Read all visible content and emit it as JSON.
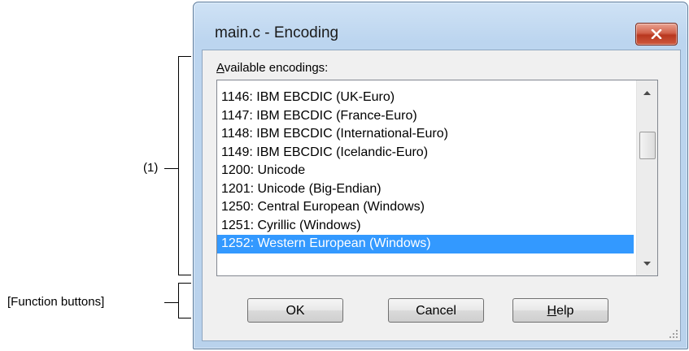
{
  "annotations": {
    "list_callout": "(1)",
    "buttons_callout": "[Function buttons]"
  },
  "window": {
    "title": "main.c - Encoding",
    "close_icon": "close-icon"
  },
  "list": {
    "label_mnemonic": "A",
    "label_rest": "vailable encodings:",
    "items": [
      "1146: IBM EBCDIC (UK-Euro)",
      "1147: IBM EBCDIC (France-Euro)",
      "1148: IBM EBCDIC (International-Euro)",
      "1149: IBM EBCDIC (Icelandic-Euro)",
      "1200: Unicode",
      "1201: Unicode (Big-Endian)",
      "1250: Central European (Windows)",
      "1251: Cyrillic (Windows)",
      "1252: Western European (Windows)"
    ],
    "selected_index": 8
  },
  "buttons": {
    "ok": "OK",
    "cancel": "Cancel",
    "help_mnemonic": "H",
    "help_rest": "elp"
  },
  "colors": {
    "selection": "#3399ff",
    "close_button": "#c7432a"
  }
}
